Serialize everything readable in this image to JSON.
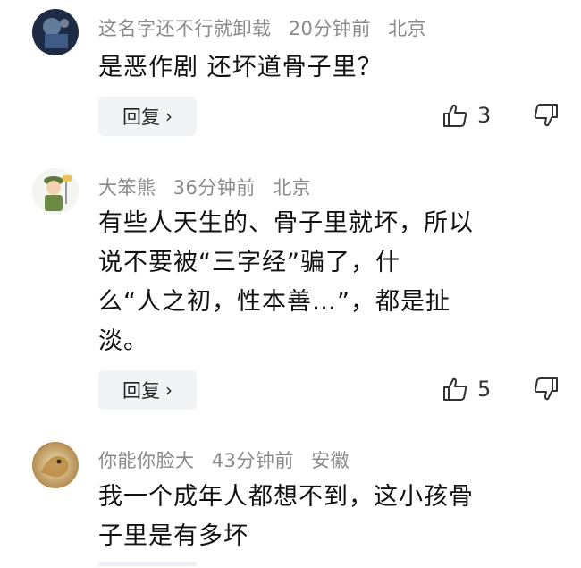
{
  "comments": [
    {
      "username": "这名字还不行就卸载",
      "time": "20分钟前",
      "location": "北京",
      "text": "是恶作剧 还坏道骨子里？",
      "reply_label": "回复",
      "likes": "3",
      "avatar_icon": "dark-blue-avatar-icon"
    },
    {
      "username": "大笨熊",
      "time": "36分钟前",
      "location": "北京",
      "text_lines": [
        "有些人天生的、骨子里就坏，所以",
        "说不要被“三字经”骗了，什",
        "么“人之初，性本善…”，都是扯",
        "淡。"
      ],
      "reply_label": "回复",
      "likes": "5",
      "avatar_icon": "cartoon-soldier-avatar-icon"
    },
    {
      "username": "你能你脸大",
      "time": "43分钟前",
      "location": "安徽",
      "text_lines": [
        "我一个成年人都想不到，这小孩骨",
        "子里是有多坏"
      ],
      "avatar_icon": "dragon-avatar-icon"
    }
  ],
  "icons": {
    "reply_chevron": "›",
    "like": "thumbs-up-icon",
    "dislike": "thumbs-down-icon"
  }
}
